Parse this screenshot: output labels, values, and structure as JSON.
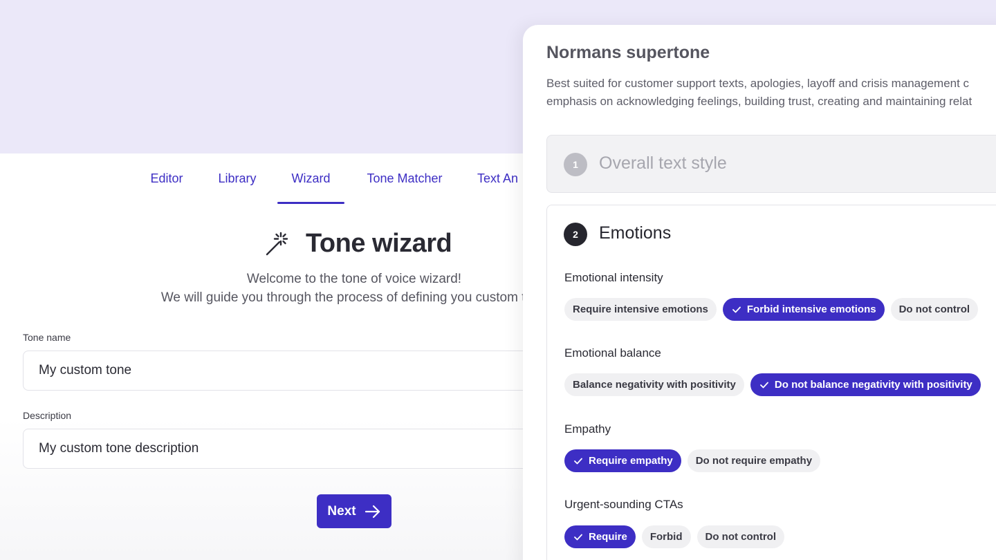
{
  "nav": {
    "tabs": [
      {
        "label": "Editor"
      },
      {
        "label": "Library"
      },
      {
        "label": "Wizard",
        "active": true
      },
      {
        "label": "Tone Matcher"
      },
      {
        "label": "Text An"
      }
    ]
  },
  "wizard": {
    "title": "Tone wizard",
    "icon": "magic-wand-icon",
    "welcome_line1": "Welcome to the tone of voice wizard!",
    "welcome_line2": "We will guide you through the process of defining you custom tone",
    "tone_name_label": "Tone name",
    "tone_name_value": "My custom tone",
    "description_label": "Description",
    "description_value": "My custom tone description",
    "next_label": "Next"
  },
  "panel": {
    "title": "Normans supertone",
    "desc_line1": "Best suited for customer support texts, apologies, layoff and crisis management c",
    "desc_line2": "emphasis on acknowledging feelings, building trust, creating and maintaining relat",
    "step1": {
      "number": "1",
      "title": "Overall text style"
    },
    "step2": {
      "number": "2",
      "title": "Emotions",
      "groups": [
        {
          "label": "Emotional intensity",
          "options": [
            {
              "text": "Require intensive emotions",
              "selected": false
            },
            {
              "text": "Forbid intensive emotions",
              "selected": true
            },
            {
              "text": "Do not control",
              "selected": false
            }
          ]
        },
        {
          "label": "Emotional balance",
          "options": [
            {
              "text": "Balance negativity with positivity",
              "selected": false
            },
            {
              "text": "Do not balance negativity with positivity",
              "selected": true
            }
          ]
        },
        {
          "label": "Empathy",
          "options": [
            {
              "text": "Require empathy",
              "selected": true
            },
            {
              "text": "Do not require empathy",
              "selected": false
            }
          ]
        },
        {
          "label": "Urgent-sounding CTAs",
          "options": [
            {
              "text": "Require",
              "selected": true
            },
            {
              "text": "Forbid",
              "selected": false
            },
            {
              "text": "Do not control",
              "selected": false
            }
          ]
        }
      ]
    }
  },
  "colors": {
    "accent": "#3d2ec4",
    "hero": "#ebe8f9"
  }
}
